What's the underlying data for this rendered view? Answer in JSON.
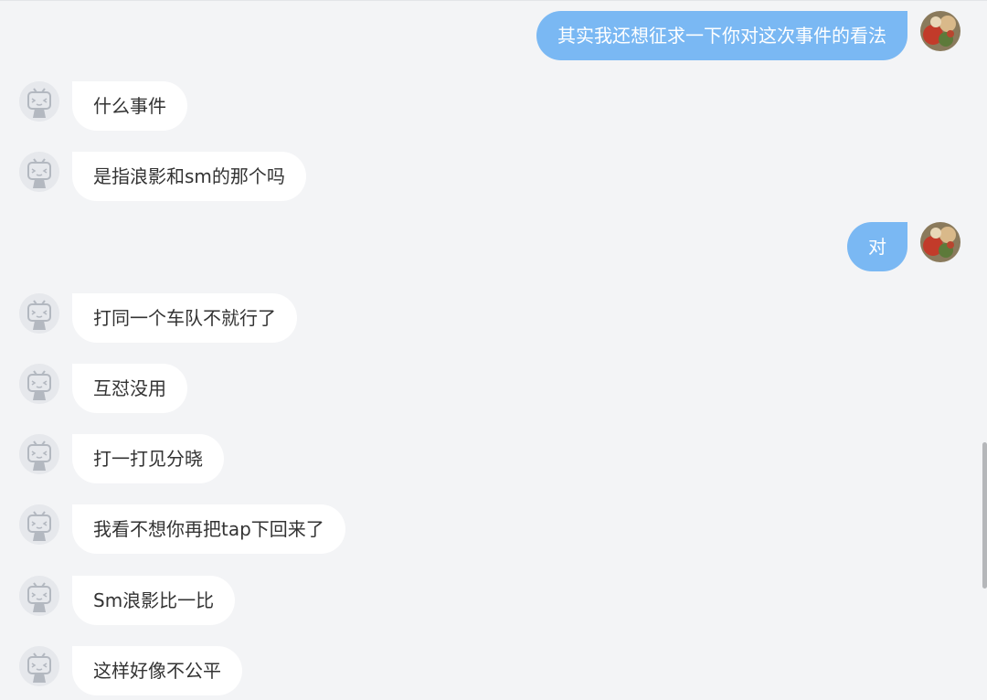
{
  "messages": [
    {
      "side": "out",
      "text": "其实我还想征求一下你对这次事件的看法"
    },
    {
      "side": "in",
      "text": "什么事件"
    },
    {
      "side": "in",
      "text": "是指浪影和sm的那个吗"
    },
    {
      "side": "out",
      "text": "对"
    },
    {
      "side": "in",
      "text": "打同一个车队不就行了"
    },
    {
      "side": "in",
      "text": "互怼没用"
    },
    {
      "side": "in",
      "text": "打一打见分晓"
    },
    {
      "side": "in",
      "text": "我看不想你再把tap下回来了"
    },
    {
      "side": "in",
      "text": "Sm浪影比一比"
    },
    {
      "side": "in",
      "text": "这样好像不公平"
    }
  ],
  "colors": {
    "background": "#f3f4f6",
    "incoming_bubble": "#ffffff",
    "incoming_text": "#333333",
    "outgoing_bubble": "#7ab8f3",
    "outgoing_text": "#ffffff",
    "default_avatar": "#e6e8ec"
  },
  "icons": {
    "incoming_avatar": "bilibili-tv-default-avatar-icon",
    "outgoing_avatar": "user-photo-avatar"
  }
}
